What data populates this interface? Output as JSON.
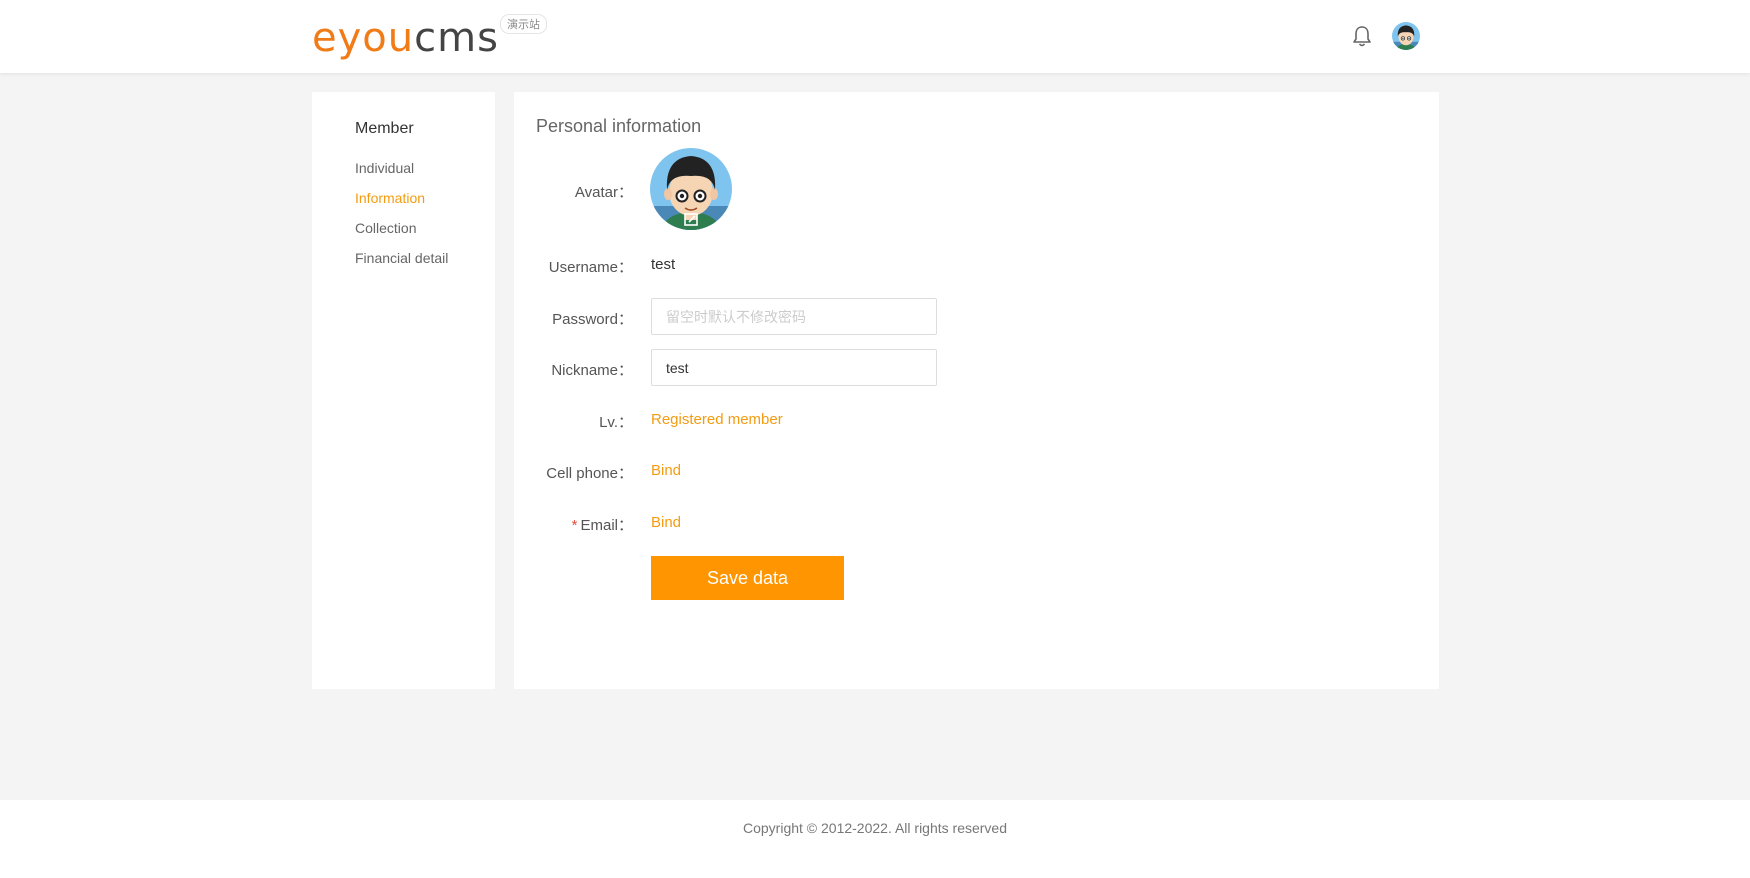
{
  "header": {
    "logo_part1": "eyou",
    "logo_part2": "cms",
    "logo_badge": "演示站",
    "icons": [
      "bell-icon",
      "user-avatar"
    ]
  },
  "sidebar": {
    "title": "Member",
    "items": [
      {
        "label": "Individual",
        "active": false
      },
      {
        "label": "Information",
        "active": true
      },
      {
        "label": "Collection",
        "active": false
      },
      {
        "label": "Financial detail",
        "active": false
      }
    ]
  },
  "main": {
    "title": "Personal information",
    "avatar_label": "Avatar：",
    "username_label": "Username：",
    "username_value": "test",
    "password_label": "Password：",
    "password_placeholder": "留空时默认不修改密码",
    "nickname_label": "Nickname：",
    "nickname_value": "test",
    "level_label": "Lv.：",
    "level_value": "Registered member",
    "phone_label": "Cell phone：",
    "phone_link": "Bind",
    "email_required_mark": "*",
    "email_label": "Email：",
    "email_link": "Bind",
    "save_label": "Save data"
  },
  "footer": {
    "copyright": "Copyright © 2012-2022. All rights reserved"
  },
  "colors": {
    "accent": "#ff9500",
    "link": "#f39c12",
    "required": "#e74c3c"
  }
}
